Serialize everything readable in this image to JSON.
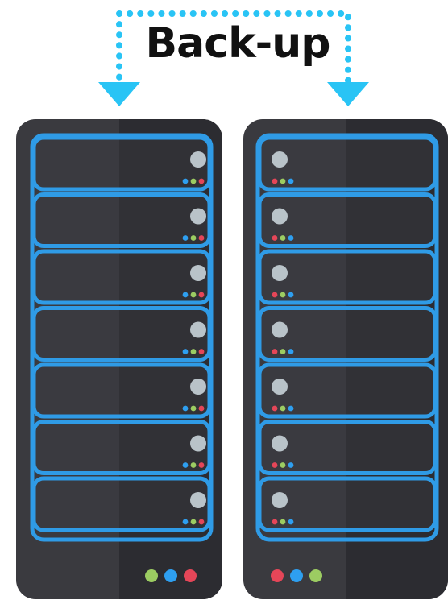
{
  "title": "Back-up",
  "colors": {
    "accent": "#29c4f5",
    "rack_body": "#3a3a3f",
    "rack_panel": "#2c2c31",
    "bay_border": "#2f9be6",
    "bay_fill": "#37373c",
    "light_gray": "#b9c3c9",
    "led_blue": "#2e9ff0",
    "led_green": "#9ccc62",
    "led_red": "#e54658"
  },
  "racks": [
    {
      "name": "server-rack-left",
      "bay_count": 7,
      "bay_led_order": [
        "blue",
        "green",
        "red"
      ],
      "footer_led_order": [
        "green",
        "blue",
        "red"
      ]
    },
    {
      "name": "server-rack-right",
      "bay_count": 7,
      "bay_led_order": [
        "red",
        "green",
        "blue"
      ],
      "footer_led_order": [
        "red",
        "blue",
        "green"
      ]
    }
  ]
}
